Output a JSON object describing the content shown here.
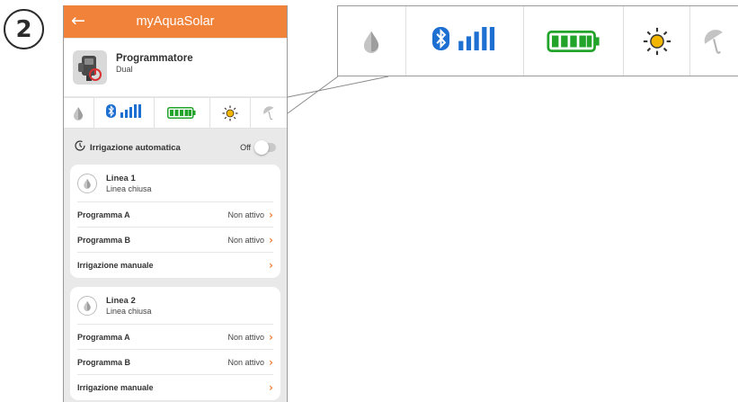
{
  "step_number": "2",
  "app": {
    "title": "myAquaSolar",
    "back_icon": "arrow-left-icon"
  },
  "device": {
    "name": "Programmatore",
    "subtitle": "Dual",
    "icon": "controller-icon"
  },
  "status_icons": [
    "water-drop-icon",
    "bluetooth-icon",
    "signal-bars-icon",
    "battery-full-icon",
    "sun-icon",
    "umbrella-icon"
  ],
  "automatic_irrigation": {
    "label": "Irrigazione automatica",
    "state": "Off",
    "enabled": false
  },
  "lines": [
    {
      "name": "Linea 1",
      "status": "Linea chiusa",
      "rows": [
        {
          "label": "Programma A",
          "value": "Non attivo"
        },
        {
          "label": "Programma B",
          "value": "Non attivo"
        },
        {
          "label": "Irrigazione manuale",
          "value": ""
        }
      ]
    },
    {
      "name": "Linea 2",
      "status": "Linea chiusa",
      "rows": [
        {
          "label": "Programma A",
          "value": "Non attivo"
        },
        {
          "label": "Programma B",
          "value": "Non attivo"
        },
        {
          "label": "Irrigazione manuale",
          "value": ""
        }
      ]
    }
  ],
  "colors": {
    "accent": "#f0823a",
    "bluetooth": "#1d6fd1",
    "battery": "#22a32a",
    "sun": "#f2b600",
    "inactive_icon": "#b5b5b5"
  }
}
